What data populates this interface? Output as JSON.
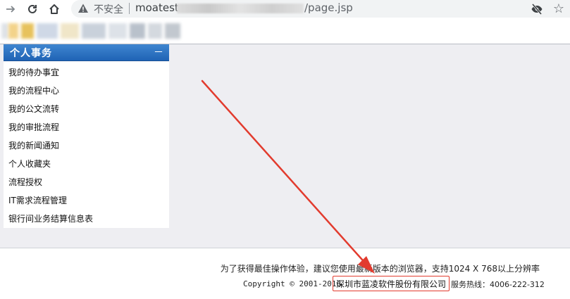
{
  "browser": {
    "insecure_label": "不安全",
    "url_host": "moatest",
    "url_path": "/page.jsp"
  },
  "sidebar": {
    "title": "个人事务",
    "collapse_glyph": "－",
    "items": [
      {
        "label": "我的待办事宜"
      },
      {
        "label": "我的流程中心"
      },
      {
        "label": "我的公文流转"
      },
      {
        "label": "我的审批流程"
      },
      {
        "label": "我的新闻通知"
      },
      {
        "label": "个人收藏夹"
      },
      {
        "label": "流程授权"
      },
      {
        "label": "IT需求流程管理"
      },
      {
        "label": "银行间业务结算信息表"
      }
    ]
  },
  "footer": {
    "note": "为了获得最佳操作体验，建议您使用最新版本的浏览器，支持1024 X 768以上分辨率",
    "copyright": "Copyright © 2001-2016",
    "company": "深圳市蓝凌软件股份有限公司",
    "hotline": "服务热线：4006-222-312"
  },
  "colors": {
    "sidebar_header": "#2a6fc0",
    "content_bg": "#eeeef2",
    "annotation": "#e23b2e"
  },
  "icons": {
    "back": "arrow-right-icon",
    "reload": "reload-icon",
    "home": "home-icon",
    "warning": "warning-icon",
    "tracking": "eye-off-icon",
    "bookmark": "star-icon"
  }
}
